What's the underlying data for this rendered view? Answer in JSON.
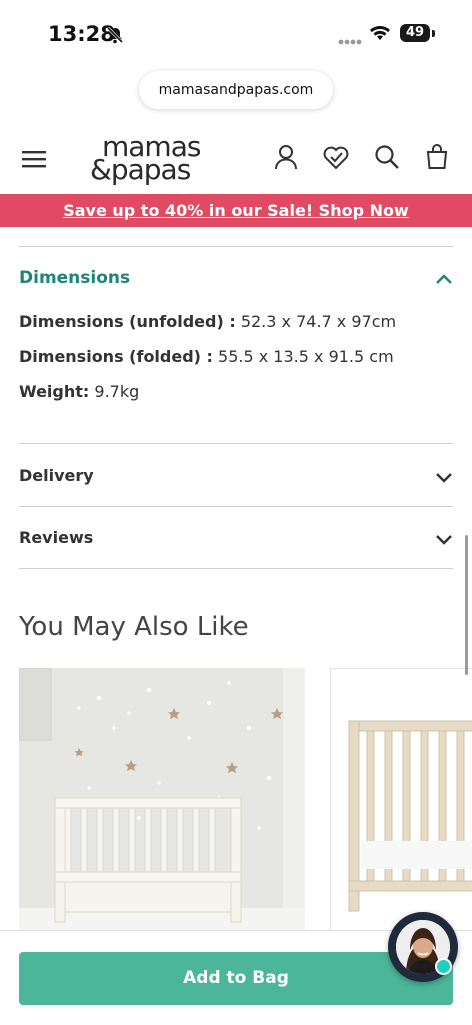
{
  "status_bar": {
    "time": "13:28",
    "battery": "49"
  },
  "browser": {
    "url": "mamasandpapas.com"
  },
  "header": {
    "logo_line1": "mamas",
    "logo_line2": "&papas"
  },
  "promo": {
    "text": "Save up to 40% in our Sale! Shop Now"
  },
  "dimensions": {
    "title": "Dimensions",
    "specs": [
      {
        "label": "Dimensions (unfolded) :",
        "value": " 52.3 x 74.7 x 97cm"
      },
      {
        "label": "Dimensions (folded) :",
        "value": " 55.5 x 13.5 x 91.5 cm"
      },
      {
        "label": "Weight:",
        "value": " 9.7kg"
      }
    ]
  },
  "accordions": [
    {
      "label": "Delivery"
    },
    {
      "label": "Reviews"
    }
  ],
  "recommendations": {
    "title": "You May Also Like"
  },
  "cta": {
    "add_to_bag": "Add to Bag"
  },
  "colors": {
    "sale_banner": "#e04a62",
    "accent_teal": "#1e8577",
    "button_green": "#4bb699"
  },
  "icons": [
    "bell-slash-icon",
    "signal-icon",
    "wifi-icon",
    "battery-icon",
    "menu-icon",
    "account-icon",
    "wishlist-heart-icon",
    "search-icon",
    "bag-icon",
    "chevron-up-icon",
    "chevron-down-icon"
  ]
}
